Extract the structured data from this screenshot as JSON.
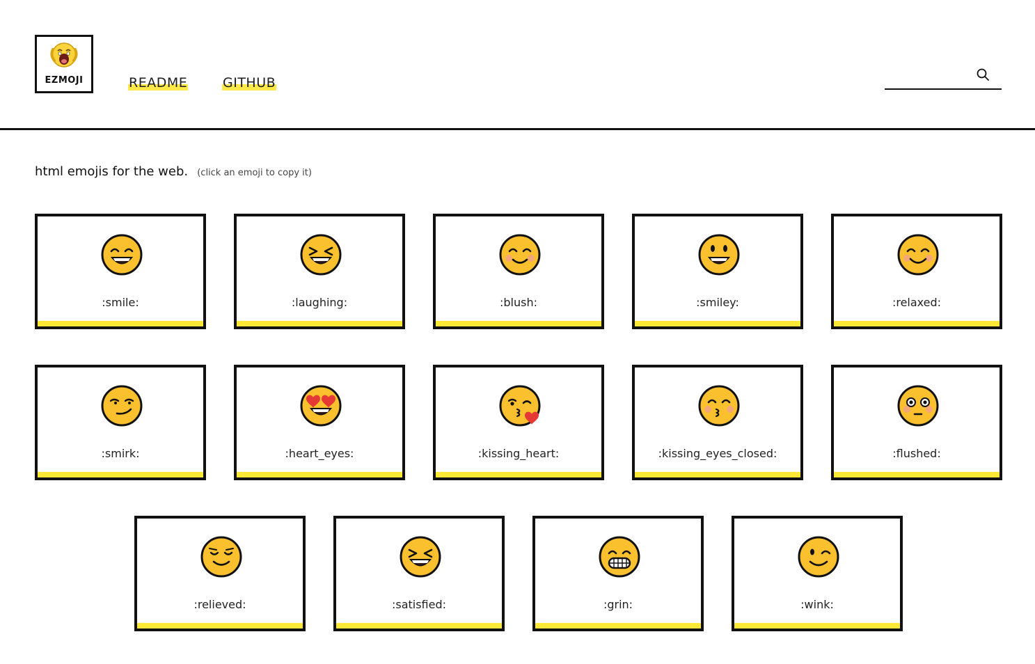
{
  "brand": {
    "name": "EZMOJI",
    "logo_icon": "screaming-face-icon"
  },
  "nav": [
    {
      "label": "README"
    },
    {
      "label": "GITHUB"
    }
  ],
  "search": {
    "value": "",
    "placeholder": "",
    "icon": "search-icon"
  },
  "intro": {
    "title": "html emojis for the web.",
    "hint": "(click an emoji to copy it)"
  },
  "emojis": [
    {
      "label": ":smile:",
      "icon": "smile-icon"
    },
    {
      "label": ":laughing:",
      "icon": "laughing-icon"
    },
    {
      "label": ":blush:",
      "icon": "blush-icon"
    },
    {
      "label": ":smiley:",
      "icon": "smiley-icon"
    },
    {
      "label": ":relaxed:",
      "icon": "relaxed-icon"
    },
    {
      "label": ":smirk:",
      "icon": "smirk-icon"
    },
    {
      "label": ":heart_eyes:",
      "icon": "heart-eyes-icon"
    },
    {
      "label": ":kissing_heart:",
      "icon": "kissing-heart-icon"
    },
    {
      "label": ":kissing_eyes_closed:",
      "icon": "kissing-eyes-closed-icon"
    },
    {
      "label": ":flushed:",
      "icon": "flushed-icon"
    },
    {
      "label": ":relieved:",
      "icon": "relieved-icon"
    },
    {
      "label": ":satisfied:",
      "icon": "satisfied-icon"
    },
    {
      "label": ":grin:",
      "icon": "grin-icon"
    },
    {
      "label": ":wink:",
      "icon": "wink-icon"
    }
  ],
  "colors": {
    "accent_yellow": "#ffe936",
    "emoji_face": "#fbc02d",
    "outline": "#111111",
    "blush": "#f4a08c",
    "heart": "#e53935"
  }
}
